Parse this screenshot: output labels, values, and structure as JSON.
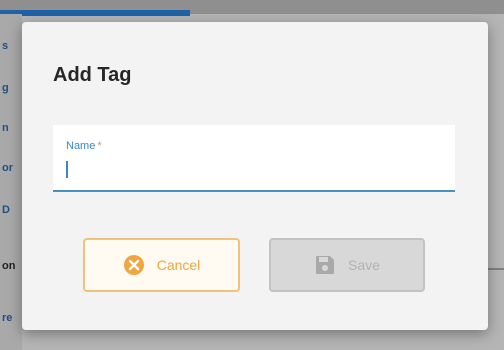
{
  "background": {
    "sidebar_fragments": [
      "s",
      "g",
      "n",
      "or",
      "D",
      "on",
      "re"
    ]
  },
  "dialog": {
    "title": "Add Tag",
    "name_field": {
      "label": "Name",
      "required_marker": "*",
      "value": ""
    },
    "cancel_button": {
      "label": "Cancel",
      "icon": "cancel-circle-icon",
      "color": "#f0a640"
    },
    "save_button": {
      "label": "Save",
      "icon": "floppy-disk-icon",
      "disabled": true
    }
  },
  "colors": {
    "accent_blue": "#3a86c4",
    "cancel_orange": "#f0a640",
    "required_orange": "#e0944a"
  }
}
